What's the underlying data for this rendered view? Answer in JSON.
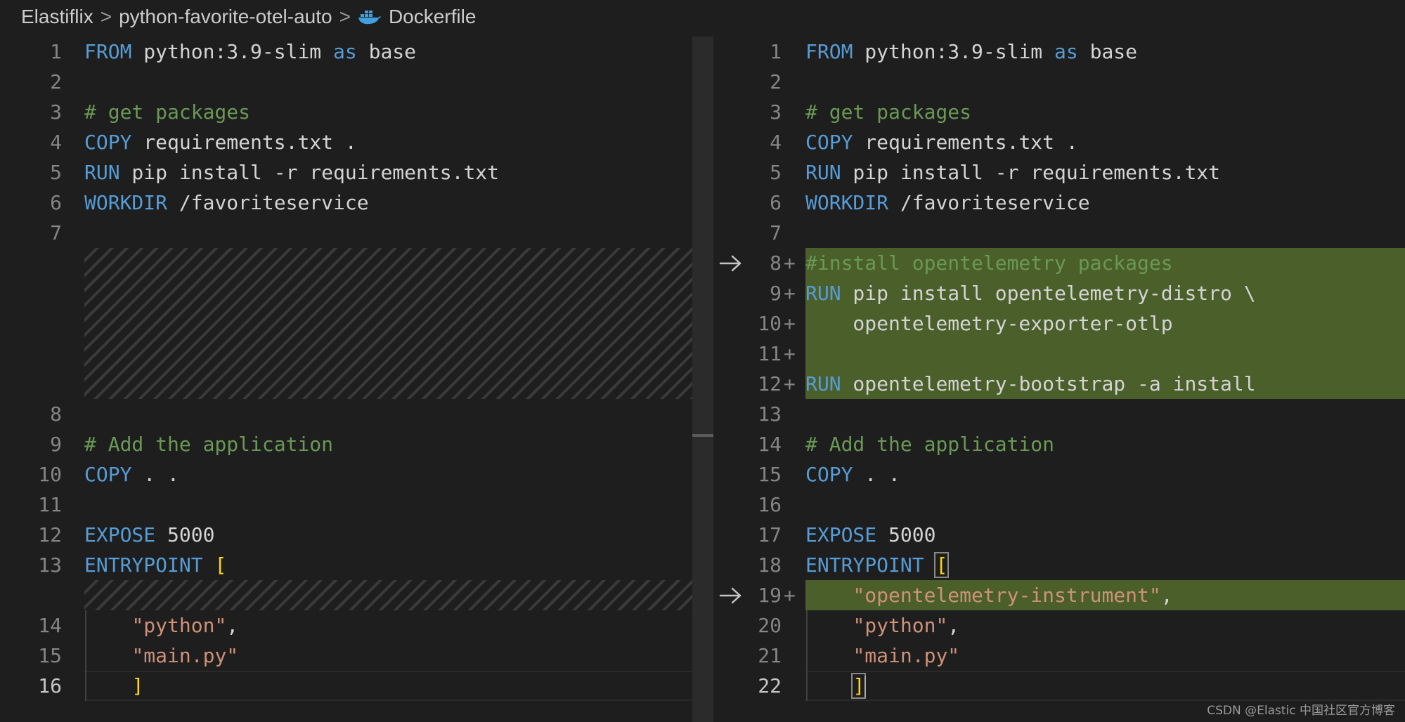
{
  "breadcrumb": {
    "items": [
      "Elastiflix",
      "python-favorite-otel-auto",
      "Dockerfile"
    ],
    "separator": ">"
  },
  "left": {
    "lines": [
      {
        "n": "1",
        "tokens": [
          {
            "t": "FROM",
            "c": "kw"
          },
          {
            "t": " python:3.9-slim "
          },
          {
            "t": "as",
            "c": "kw"
          },
          {
            "t": " base"
          }
        ]
      },
      {
        "n": "2",
        "tokens": []
      },
      {
        "n": "3",
        "tokens": [
          {
            "t": "# get packages",
            "c": "cm"
          }
        ]
      },
      {
        "n": "4",
        "tokens": [
          {
            "t": "COPY",
            "c": "kw"
          },
          {
            "t": " requirements.txt ."
          }
        ]
      },
      {
        "n": "5",
        "tokens": [
          {
            "t": "RUN",
            "c": "kw"
          },
          {
            "t": " pip install -r requirements.txt"
          }
        ]
      },
      {
        "n": "6",
        "tokens": [
          {
            "t": "WORKDIR",
            "c": "kw"
          },
          {
            "t": " /favoriteservice"
          }
        ]
      },
      {
        "n": "7",
        "tokens": []
      },
      {
        "n": "8",
        "tokens": []
      },
      {
        "n": "9",
        "tokens": [
          {
            "t": "# Add the application",
            "c": "cm"
          }
        ]
      },
      {
        "n": "10",
        "tokens": [
          {
            "t": "COPY",
            "c": "kw"
          },
          {
            "t": " . ."
          }
        ]
      },
      {
        "n": "11",
        "tokens": []
      },
      {
        "n": "12",
        "tokens": [
          {
            "t": "EXPOSE",
            "c": "kw"
          },
          {
            "t": " 5000"
          }
        ]
      },
      {
        "n": "13",
        "tokens": [
          {
            "t": "ENTRYPOINT",
            "c": "kw"
          },
          {
            "t": " "
          },
          {
            "t": "[",
            "c": "br"
          }
        ]
      },
      {
        "n": "14",
        "tokens": [
          {
            "t": "    "
          },
          {
            "t": "\"python\"",
            "c": "str"
          },
          {
            "t": ","
          }
        ]
      },
      {
        "n": "15",
        "tokens": [
          {
            "t": "    "
          },
          {
            "t": "\"main.py\"",
            "c": "str"
          }
        ]
      },
      {
        "n": "16",
        "tokens": [
          {
            "t": "    "
          },
          {
            "t": "]",
            "c": "br"
          }
        ]
      }
    ]
  },
  "right": {
    "lines": [
      {
        "n": "1",
        "tokens": [
          {
            "t": "FROM",
            "c": "kw"
          },
          {
            "t": " python:3.9-slim "
          },
          {
            "t": "as",
            "c": "kw"
          },
          {
            "t": " base"
          }
        ]
      },
      {
        "n": "2",
        "tokens": []
      },
      {
        "n": "3",
        "tokens": [
          {
            "t": "# get packages",
            "c": "cm"
          }
        ]
      },
      {
        "n": "4",
        "tokens": [
          {
            "t": "COPY",
            "c": "kw"
          },
          {
            "t": " requirements.txt ."
          }
        ]
      },
      {
        "n": "5",
        "tokens": [
          {
            "t": "RUN",
            "c": "kw"
          },
          {
            "t": " pip install -r requirements.txt"
          }
        ]
      },
      {
        "n": "6",
        "tokens": [
          {
            "t": "WORKDIR",
            "c": "kw"
          },
          {
            "t": " /favoriteservice"
          }
        ]
      },
      {
        "n": "7",
        "tokens": []
      },
      {
        "n": "8",
        "added": true,
        "tokens": [
          {
            "t": "#install opentelemetry packages",
            "c": "cm"
          }
        ]
      },
      {
        "n": "9",
        "added": true,
        "tokens": [
          {
            "t": "RUN",
            "c": "kw"
          },
          {
            "t": " pip install opentelemetry-distro \\"
          }
        ]
      },
      {
        "n": "10",
        "added": true,
        "tokens": [
          {
            "t": "    opentelemetry-exporter-otlp"
          }
        ]
      },
      {
        "n": "11",
        "added": true,
        "tokens": []
      },
      {
        "n": "12",
        "added": true,
        "tokens": [
          {
            "t": "RUN",
            "c": "kw"
          },
          {
            "t": " opentelemetry-bootstrap -a install"
          }
        ]
      },
      {
        "n": "13",
        "tokens": []
      },
      {
        "n": "14",
        "tokens": [
          {
            "t": "# Add the application",
            "c": "cm"
          }
        ]
      },
      {
        "n": "15",
        "tokens": [
          {
            "t": "COPY",
            "c": "kw"
          },
          {
            "t": " . ."
          }
        ]
      },
      {
        "n": "16",
        "tokens": []
      },
      {
        "n": "17",
        "tokens": [
          {
            "t": "EXPOSE",
            "c": "kw"
          },
          {
            "t": " 5000"
          }
        ]
      },
      {
        "n": "18",
        "tokens": [
          {
            "t": "ENTRYPOINT",
            "c": "kw"
          },
          {
            "t": " "
          },
          {
            "t": "[",
            "c": "br",
            "box": true
          }
        ]
      },
      {
        "n": "19",
        "added": true,
        "tokens": [
          {
            "t": "    "
          },
          {
            "t": "\"opentelemetry-instrument\"",
            "c": "str"
          },
          {
            "t": ","
          }
        ]
      },
      {
        "n": "20",
        "tokens": [
          {
            "t": "    "
          },
          {
            "t": "\"python\"",
            "c": "str"
          },
          {
            "t": ","
          }
        ]
      },
      {
        "n": "21",
        "tokens": [
          {
            "t": "    "
          },
          {
            "t": "\"main.py\"",
            "c": "str"
          }
        ]
      },
      {
        "n": "22",
        "tokens": [
          {
            "t": "    "
          },
          {
            "t": "]",
            "c": "br",
            "box": true
          },
          {
            "cursor": true
          }
        ]
      }
    ]
  },
  "added_marker": "+",
  "icons": {
    "diff_arrow": "arrow-right-icon",
    "file_icon": "docker-icon"
  },
  "colors": {
    "keyword": "#569cd6",
    "comment": "#6a9955",
    "string": "#ce9178",
    "bracket": "#ffd700",
    "added_bg": "#4b5f2b"
  },
  "watermark": "CSDN @Elastic 中国社区官方博客"
}
